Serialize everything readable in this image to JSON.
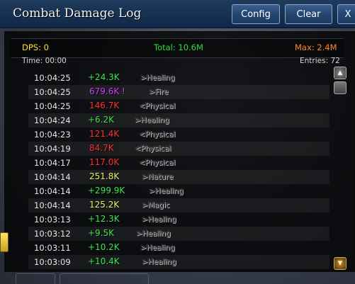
{
  "window": {
    "title": "Combat Damage Log"
  },
  "toolbar": {
    "config_label": "Config",
    "clear_label": "Clear",
    "close_label": "X"
  },
  "stats": {
    "dps_label": "DPS: 0",
    "total_label": "Total: 10.6M",
    "max_label": "Max: 2.4M",
    "time_label": "Time: 00:00",
    "entries_label": "Entries: 72"
  },
  "colors": {
    "healing": "#3ee84e",
    "fire": "#d040ff",
    "physical": "#ff3030",
    "nature": "#f0f060",
    "magic": "#f0f060"
  },
  "log": [
    {
      "time": "10:04:25",
      "value": "+24.3K",
      "school": ">Healing",
      "kind": "healing"
    },
    {
      "time": "10:04:25",
      "value": "679.6K !",
      "school": ">Fire",
      "kind": "fire"
    },
    {
      "time": "10:04:25",
      "value": "146.7K",
      "school": "<Physical",
      "kind": "physical"
    },
    {
      "time": "10:04:24",
      "value": "+6.2K",
      "school": ">Healing",
      "kind": "healing"
    },
    {
      "time": "10:04:23",
      "value": "121.4K",
      "school": "<Physical",
      "kind": "physical"
    },
    {
      "time": "10:04:19",
      "value": "84.7K",
      "school": "<Physical",
      "kind": "physical"
    },
    {
      "time": "10:04:17",
      "value": "117.0K",
      "school": "<Physical",
      "kind": "physical"
    },
    {
      "time": "10:04:14",
      "value": "251.8K",
      "school": ">Nature",
      "kind": "nature"
    },
    {
      "time": "10:04:14",
      "value": "+299.9K",
      "school": ">Healing",
      "kind": "healing"
    },
    {
      "time": "10:04:14",
      "value": "125.2K",
      "school": ">Magic",
      "kind": "magic"
    },
    {
      "time": "10:03:13",
      "value": "+12.3K",
      "school": ">Healing",
      "kind": "healing"
    },
    {
      "time": "10:03:12",
      "value": "+9.5K",
      "school": ">Healing",
      "kind": "healing"
    },
    {
      "time": "10:03:11",
      "value": "+10.2K",
      "school": ">Healing",
      "kind": "healing"
    },
    {
      "time": "10:03:09",
      "value": "+10.4K",
      "school": ">Healing",
      "kind": "healing"
    }
  ],
  "icons": {
    "scroll_up": "arrow-up-icon",
    "scroll_bottom": "scroll-to-bottom-icon"
  }
}
